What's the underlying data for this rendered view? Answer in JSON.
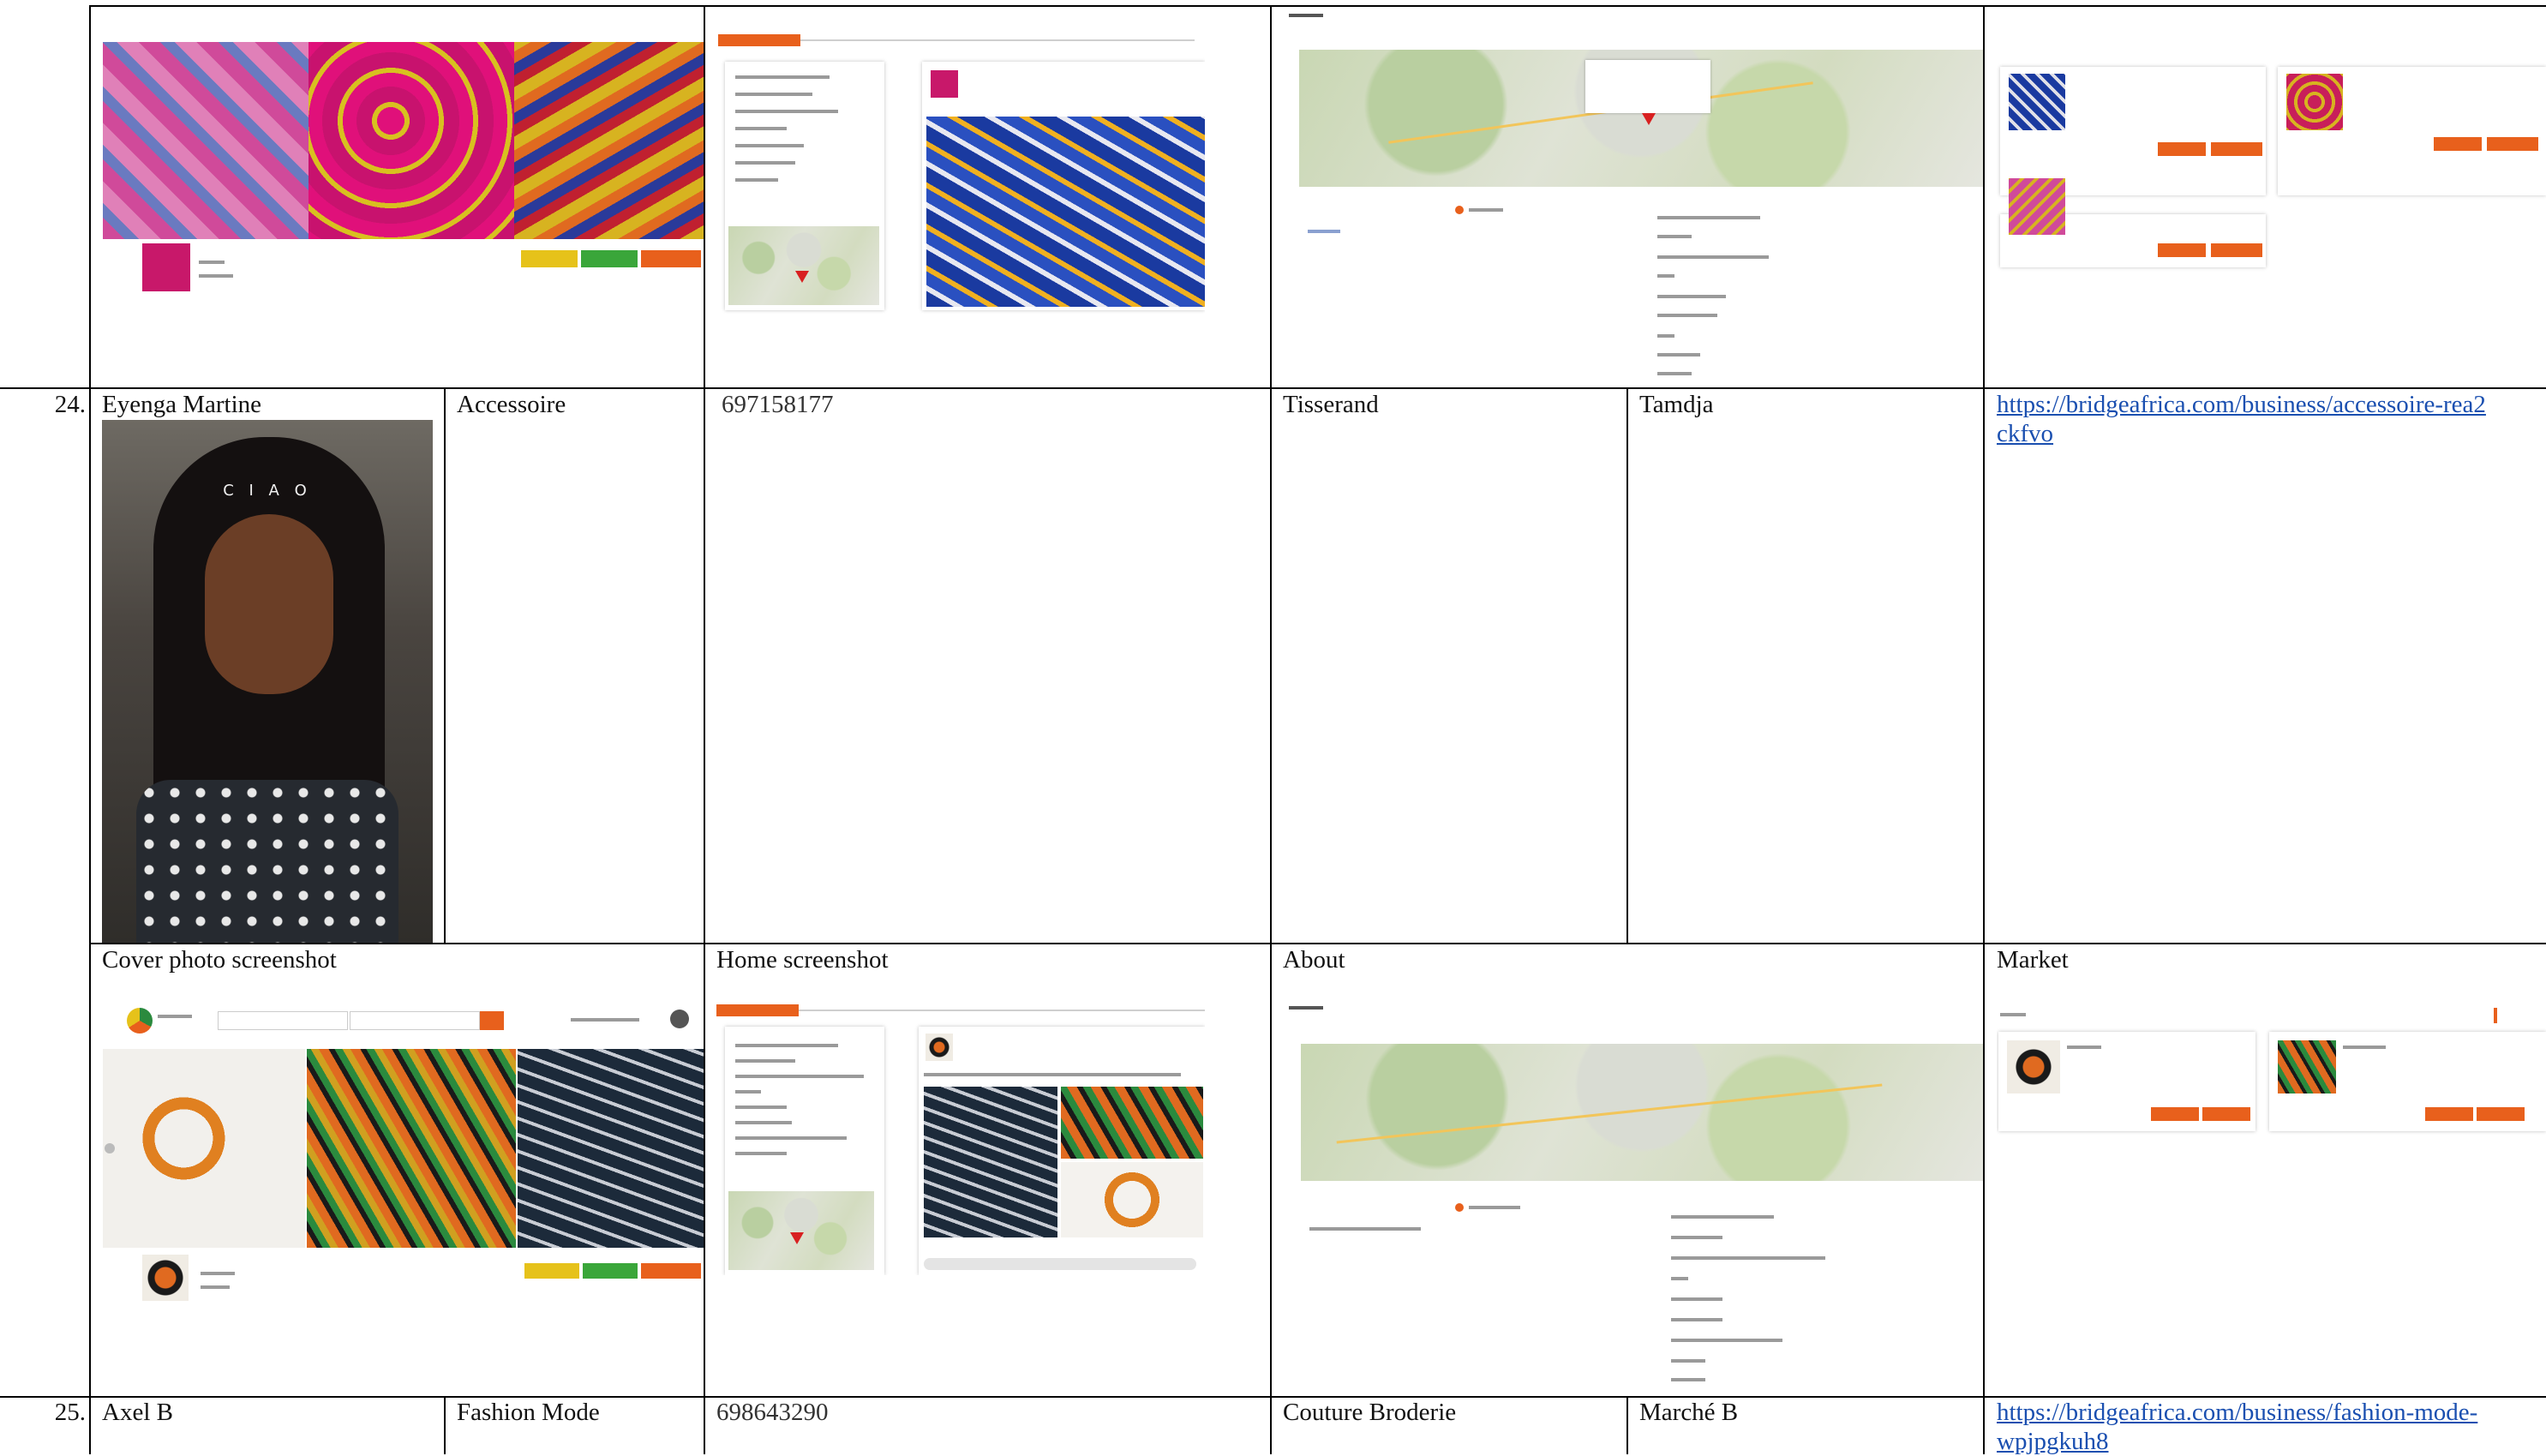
{
  "rows": [
    {
      "num": "24.",
      "name": "Eyenga Martine",
      "business": "Accessoire",
      "phone": "697158177",
      "category": "Tisserand",
      "location": "Tamdja",
      "url": "https://bridgeafrica.com/business/accessoire-rea2ckfvo"
    },
    {
      "num": "25.",
      "name": "Axel B",
      "business": "Fashion Mode",
      "phone": "698643290",
      "category": "Couture Broderie",
      "location": "Marché B",
      "url": "https://bridgeafrica.com/business/fashion-mode-wpjpgkuh8"
    }
  ],
  "section_labels": {
    "cover": "Cover photo screenshot",
    "home": "Home screenshot",
    "about": "About",
    "market": "Market"
  },
  "selfie_text": "C I A O",
  "colors": {
    "accent": "#e8601c",
    "link": "#1a4fb0",
    "grid": "#000000"
  }
}
